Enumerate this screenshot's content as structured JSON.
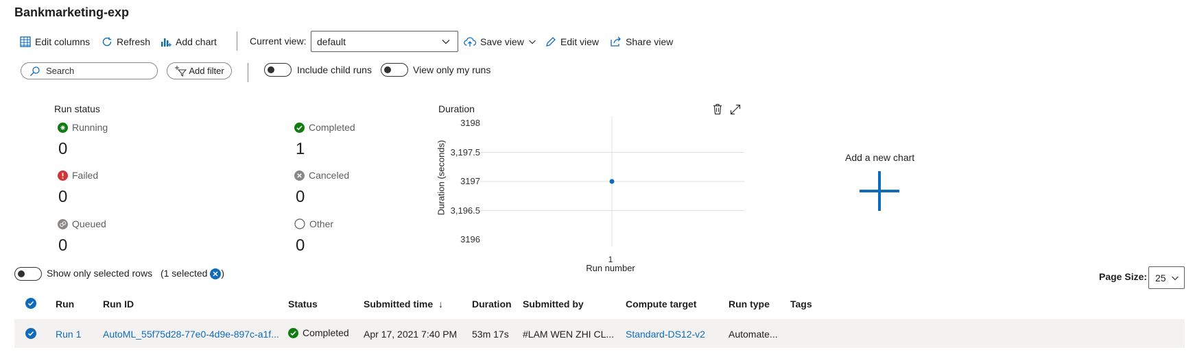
{
  "page": {
    "title": "Bankmarketing-exp"
  },
  "toolbar": {
    "edit_columns": "Edit columns",
    "refresh": "Refresh",
    "add_chart": "Add chart",
    "current_view_label": "Current view:",
    "current_view_value": "default",
    "save_view": "Save view",
    "edit_view": "Edit view",
    "share_view": "Share view"
  },
  "filters": {
    "search_placeholder": "Search",
    "add_filter": "Add filter",
    "include_child_runs": "Include child runs",
    "view_only_my_runs": "View only my runs"
  },
  "run_status": {
    "title": "Run status",
    "items": [
      {
        "label": "Running",
        "count": "0",
        "color": "#107c10"
      },
      {
        "label": "Completed",
        "count": "1",
        "color": "#107c10"
      },
      {
        "label": "Failed",
        "count": "0",
        "color": "#d13438"
      },
      {
        "label": "Canceled",
        "count": "0",
        "color": "#8a8886"
      },
      {
        "label": "Queued",
        "count": "0",
        "color": "#8a8886"
      },
      {
        "label": "Other",
        "count": "0",
        "color": "#8a8886"
      }
    ]
  },
  "chart_data": {
    "type": "scatter",
    "title": "Duration",
    "xlabel": "Run number",
    "ylabel": "Duration (seconds)",
    "ylim": [
      3196,
      3198
    ],
    "yticks": [
      "3198",
      "3,197.5",
      "3197",
      "3,196.5",
      "3196"
    ],
    "xticks": [
      "1"
    ],
    "x": [
      1
    ],
    "y": [
      3197
    ],
    "color": "#0f6cbd",
    "grid": true
  },
  "add_chart_panel": {
    "label": "Add a new chart"
  },
  "selection": {
    "show_only_selected": "Show only selected rows",
    "selected_count": "(1 selected",
    "close_paren": ")"
  },
  "pagination": {
    "label": "Page Size:",
    "value": "25"
  },
  "table": {
    "columns": [
      "Run",
      "Run ID",
      "Status",
      "Submitted time",
      "Duration",
      "Submitted by",
      "Compute target",
      "Run type",
      "Tags"
    ],
    "sort_arrow": "↓",
    "rows": [
      {
        "run": "Run 1",
        "run_id": "AutoML_55f75d28-77e0-4d9e-897c-a1f...",
        "status": "Completed",
        "submitted_time": "Apr 17, 2021 7:40 PM",
        "duration": "53m 17s",
        "submitted_by": "#LAM WEN ZHI CL...",
        "compute_target": "Standard-DS12-v2",
        "run_type": "Automate...",
        "tags": ""
      }
    ]
  },
  "colors": {
    "accent": "#0f6cbd",
    "success": "#107c10",
    "error": "#d13438"
  }
}
